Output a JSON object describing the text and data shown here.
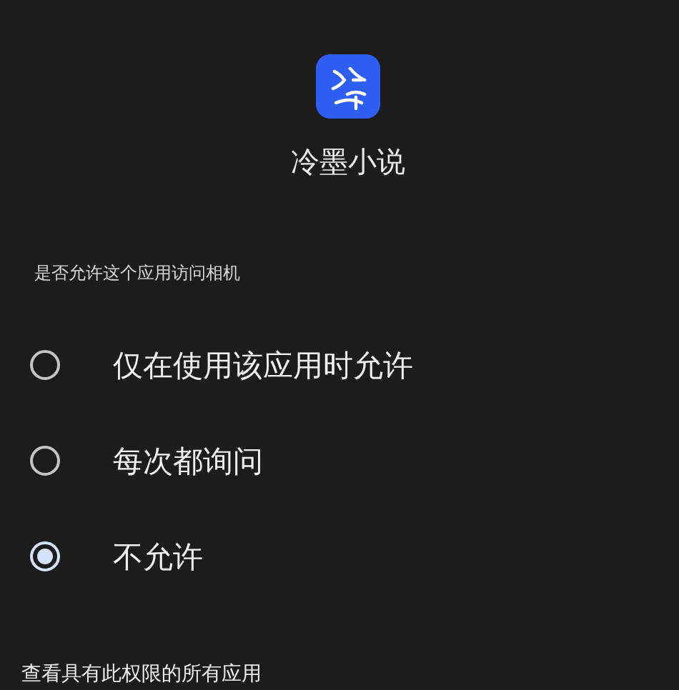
{
  "app": {
    "name": "冷墨小说"
  },
  "question": "是否允许这个应用访问相机",
  "options": [
    {
      "label": "仅在使用该应用时允许",
      "selected": false
    },
    {
      "label": "每次都询问",
      "selected": false
    },
    {
      "label": "不允许",
      "selected": true
    }
  ],
  "footer_link": "查看具有此权限的所有应用"
}
